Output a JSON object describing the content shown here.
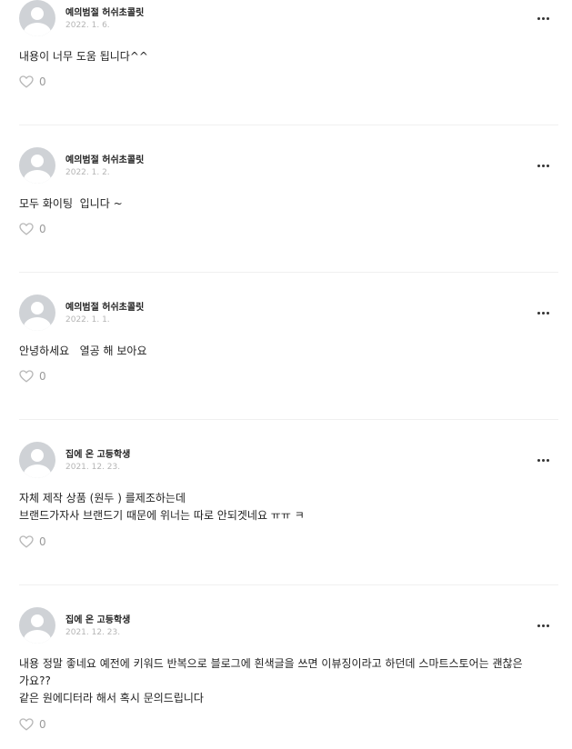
{
  "comments": [
    {
      "author": "예의범절 허쉬초콜릿",
      "date": "2022. 1. 6.",
      "lines": [
        "내용이 너무 도움 됩니다^^"
      ],
      "likes": "0"
    },
    {
      "author": "예의범절 허쉬초콜릿",
      "date": "2022. 1. 2.",
      "lines": [
        "모두 화이팅  입니다 ~"
      ],
      "likes": "0"
    },
    {
      "author": "예의범절 허쉬초콜릿",
      "date": "2022. 1. 1.",
      "lines": [
        "안녕하세요   열공 해 보아요"
      ],
      "likes": "0"
    },
    {
      "author": "집에 온 고등학생",
      "date": "2021. 12. 23.",
      "lines": [
        "자체 제작 상품 (원두 ) 를제조하는데",
        "브랜드가자사 브랜드기 때문에 위너는 따로 안되겟네요 ㅠㅠ ㅋ"
      ],
      "likes": "0"
    },
    {
      "author": "집에 온 고등학생",
      "date": "2021. 12. 23.",
      "lines": [
        "내용 정말 좋네요 예전에 키워드 반복으로 블로그에 흰색글을 쓰면 이뷰징이라고 하던데 스마트스토어는 괜찮은",
        "가요??",
        "같은 원에디터라 해서 혹시 문의드립니다"
      ],
      "likes": "0"
    }
  ],
  "icons": {
    "more": "more-dots-icon",
    "like": "heart-outline-icon",
    "avatar": "default-avatar-icon"
  },
  "colors": {
    "avatar_bg": "#cfd2d6",
    "date": "#b5b5b5",
    "like_count": "#9a9a9a",
    "divider": "#f0f0f0"
  }
}
